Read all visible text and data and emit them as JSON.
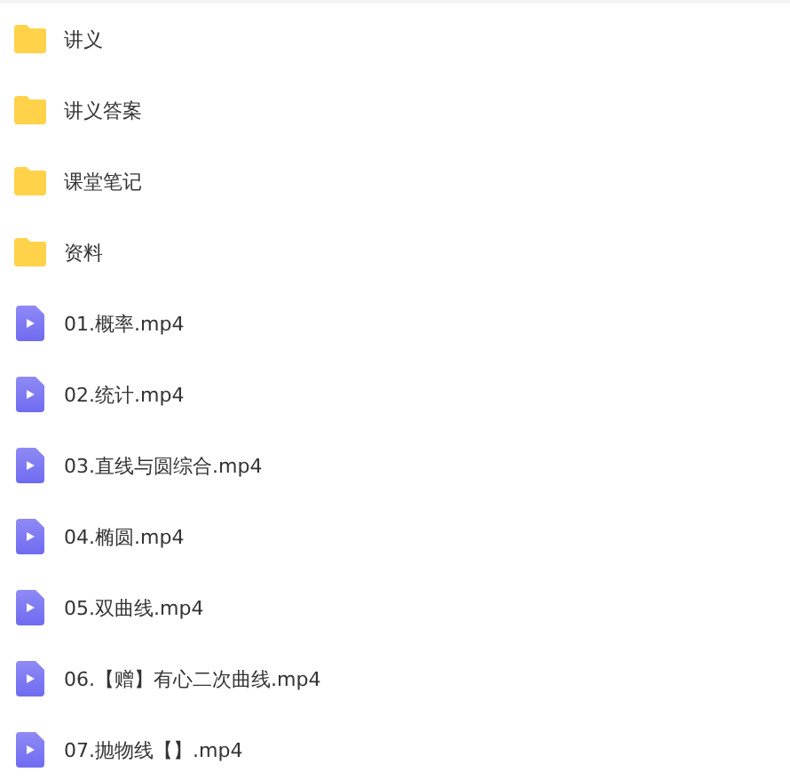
{
  "files": [
    {
      "kind": "folder",
      "name": "讲义"
    },
    {
      "kind": "folder",
      "name": "讲义答案"
    },
    {
      "kind": "folder",
      "name": "课堂笔记"
    },
    {
      "kind": "folder",
      "name": "资料"
    },
    {
      "kind": "video",
      "name": "01.概率.mp4"
    },
    {
      "kind": "video",
      "name": "02.统计.mp4"
    },
    {
      "kind": "video",
      "name": "03.直线与圆综合.mp4"
    },
    {
      "kind": "video",
      "name": "04.椭圆.mp4"
    },
    {
      "kind": "video",
      "name": "05.双曲线.mp4"
    },
    {
      "kind": "video",
      "name": "06.【赠】有心二次曲线.mp4"
    },
    {
      "kind": "video",
      "name": "07.抛物线【】.mp4"
    }
  ]
}
